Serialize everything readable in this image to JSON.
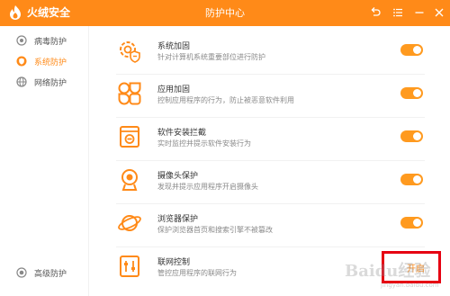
{
  "app": {
    "name": "火绒安全",
    "window_title": "防护中心"
  },
  "window_controls": [
    "back-icon",
    "menu-icon",
    "minimize-icon",
    "close-icon"
  ],
  "sidebar": {
    "items": [
      {
        "label": "病毒防护",
        "icon": "virus-shield-icon",
        "active": false
      },
      {
        "label": "系统防护",
        "icon": "system-shield-icon",
        "active": true
      },
      {
        "label": "网络防护",
        "icon": "network-shield-icon",
        "active": false
      }
    ],
    "bottom_item": {
      "label": "高级防护",
      "icon": "advanced-shield-icon"
    }
  },
  "features": [
    {
      "title": "系统加固",
      "desc": "针对计算机系统重要部位进行防护",
      "icon": "gear-shield-icon",
      "control": "toggle",
      "enabled": true
    },
    {
      "title": "应用加固",
      "desc": "控制应用程序的行为，防止被恶意软件利用",
      "icon": "apps-grid-icon",
      "control": "toggle",
      "enabled": true
    },
    {
      "title": "软件安装拦截",
      "desc": "实时监控并提示软件安装行为",
      "icon": "install-block-icon",
      "control": "toggle",
      "enabled": true
    },
    {
      "title": "摄像头保护",
      "desc": "发现并提示应用程序开启摄像头",
      "icon": "webcam-icon",
      "control": "toggle",
      "enabled": true
    },
    {
      "title": "浏览器保护",
      "desc": "保护浏览器首页和搜索引擎不被篡改",
      "icon": "planet-browser-icon",
      "control": "toggle",
      "enabled": true
    },
    {
      "title": "联网控制",
      "desc": "管控应用程序的联网行为",
      "icon": "network-control-icon",
      "control": "link",
      "link_label": "开启"
    }
  ],
  "watermark": {
    "main": "Baidu经验",
    "sub": "jingyan.baidu.com"
  },
  "colors": {
    "accent": "#ff8a18",
    "toggle_on": "#ff9a1f",
    "highlight": "#e60012"
  }
}
